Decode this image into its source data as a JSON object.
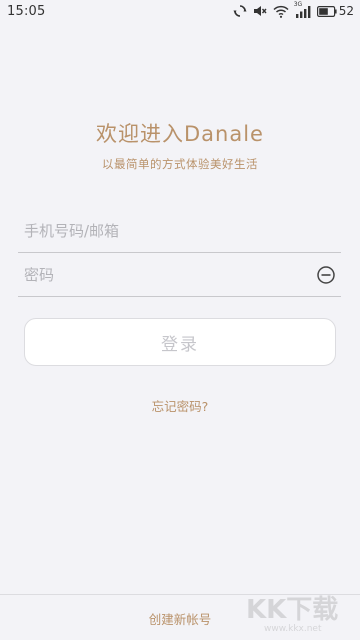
{
  "status_bar": {
    "time": "15:05",
    "signal_label": "3G",
    "battery_level": "52",
    "icons": [
      "sync-icon",
      "mute-icon",
      "wifi-icon",
      "signal-icon",
      "battery-icon"
    ]
  },
  "header": {
    "title": "欢迎进入Danale",
    "subtitle": "以最简单的方式体验美好生活"
  },
  "login_form": {
    "phone_placeholder": "手机号码/邮箱",
    "phone_value": "",
    "password_placeholder": "密码",
    "password_value": "",
    "login_label": "登录",
    "forgot_label": "忘记密码?"
  },
  "footer": {
    "create_account_label": "创建新帐号"
  },
  "watermark": {
    "brand": "KK下载",
    "url": "www.kkx.net"
  },
  "colors": {
    "background": "#f3f3f7",
    "accent": "#b9926a",
    "divider": "#c8c8cc",
    "button_text_disabled": "#c6c6cb"
  }
}
